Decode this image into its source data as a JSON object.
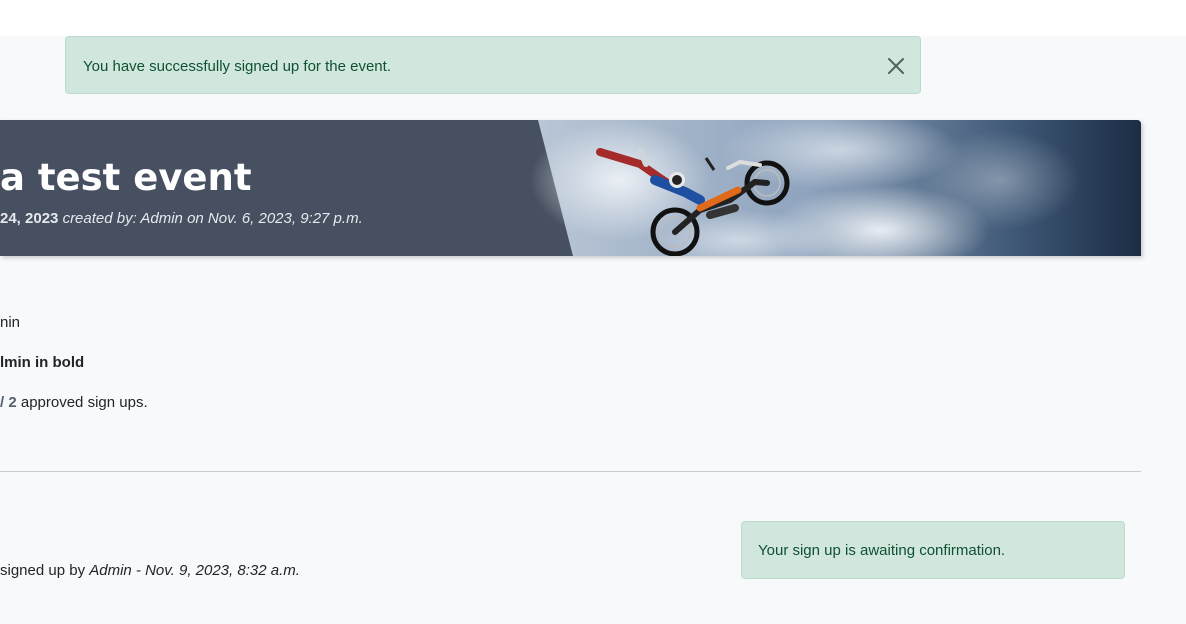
{
  "alerts": {
    "top_message": "You have successfully signed up for the event.",
    "bottom_message": "Your sign up is awaiting confirmation."
  },
  "event": {
    "title": "a test event",
    "date": "24, 2023",
    "created": "created by: Admin on Nov. 6, 2023, 9:27 p.m."
  },
  "details": {
    "line1": "nin",
    "line2": "lmin in bold",
    "count": "/ 2",
    "count_suffix": " approved sign ups."
  },
  "signup": {
    "prefix": "signed up by ",
    "detail": "Admin - Nov. 9, 2023, 8:32 a.m."
  },
  "icons": {
    "close": "close-icon",
    "hero": "motocross-rider-image"
  },
  "colors": {
    "success_bg": "#d1e7dd",
    "success_text": "#0f5132",
    "hero_bg": "#465060",
    "page_bg": "#f8f9fa"
  }
}
